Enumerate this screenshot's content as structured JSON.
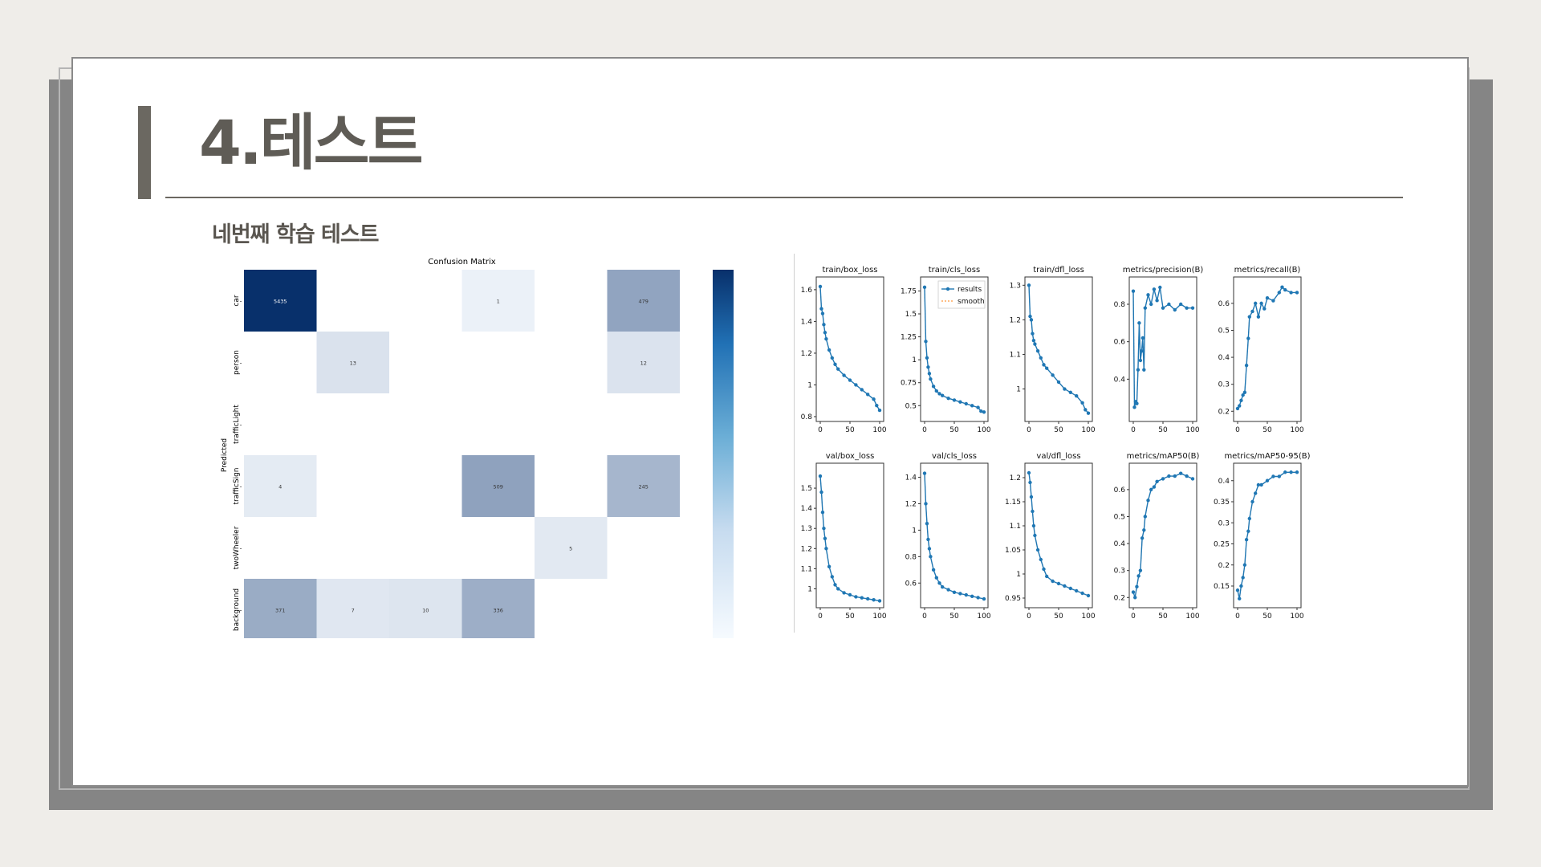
{
  "slide": {
    "title": "4.테스트",
    "subtitle": "네번째 학습 테스트"
  },
  "colors": {
    "accent": "#6b6861",
    "cm_dark": "#08306b",
    "series_blue": "#1f77b4",
    "smooth_orange": "#ff7f0e"
  },
  "chart_data": [
    {
      "type": "heatmap",
      "title": "Confusion Matrix",
      "ylabel": "Predicted",
      "rows": [
        "car",
        "person",
        "trafficLight",
        "trafficSign",
        "twoWheeler",
        "background"
      ],
      "colorbar": true,
      "cells": [
        [
          5435,
          null,
          null,
          1,
          null,
          479
        ],
        [
          null,
          13,
          null,
          null,
          null,
          12
        ],
        [
          null,
          null,
          null,
          null,
          null,
          null
        ],
        [
          4,
          null,
          null,
          509,
          null,
          245
        ],
        [
          null,
          null,
          null,
          null,
          5,
          null
        ],
        [
          371,
          7,
          10,
          336,
          null,
          null
        ]
      ],
      "vmax": 5435
    },
    {
      "type": "line",
      "legend": [
        "results",
        "smooth"
      ],
      "legend_placement": "top-right",
      "xticks": [
        0,
        50,
        100
      ],
      "subplots": [
        {
          "title": "train/box_loss",
          "yticks": [
            0.8,
            1.0,
            1.2,
            1.4,
            1.6
          ],
          "ylim": [
            0.8,
            1.65
          ],
          "x": [
            0,
            2,
            4,
            6,
            8,
            10,
            15,
            20,
            25,
            30,
            40,
            50,
            60,
            70,
            80,
            90,
            95,
            100
          ],
          "y": [
            1.62,
            1.48,
            1.45,
            1.38,
            1.33,
            1.29,
            1.22,
            1.17,
            1.13,
            1.1,
            1.06,
            1.03,
            1.0,
            0.97,
            0.94,
            0.91,
            0.87,
            0.84
          ]
        },
        {
          "title": "train/cls_loss",
          "yticks": [
            0.5,
            0.75,
            1.0,
            1.25,
            1.5,
            1.75
          ],
          "ylim": [
            0.38,
            1.85
          ],
          "x": [
            0,
            2,
            4,
            6,
            8,
            10,
            15,
            20,
            25,
            30,
            40,
            50,
            60,
            70,
            80,
            90,
            95,
            100
          ],
          "y": [
            1.79,
            1.2,
            1.02,
            0.92,
            0.85,
            0.79,
            0.71,
            0.66,
            0.63,
            0.61,
            0.58,
            0.56,
            0.54,
            0.52,
            0.5,
            0.48,
            0.44,
            0.43
          ]
        },
        {
          "title": "train/dfl_loss",
          "yticks": [
            1.0,
            1.1,
            1.2,
            1.3
          ],
          "ylim": [
            0.92,
            1.31
          ],
          "x": [
            0,
            2,
            4,
            6,
            8,
            10,
            15,
            20,
            25,
            30,
            40,
            50,
            60,
            70,
            80,
            90,
            95,
            100
          ],
          "y": [
            1.3,
            1.21,
            1.2,
            1.16,
            1.14,
            1.13,
            1.11,
            1.09,
            1.07,
            1.06,
            1.04,
            1.02,
            1.0,
            0.99,
            0.98,
            0.96,
            0.94,
            0.93
          ]
        },
        {
          "title": "metrics/precision(B)",
          "yticks": [
            0.4,
            0.6,
            0.8
          ],
          "ylim": [
            0.2,
            0.92
          ],
          "x": [
            0,
            2,
            4,
            6,
            8,
            10,
            12,
            14,
            16,
            18,
            20,
            25,
            30,
            35,
            40,
            45,
            50,
            60,
            70,
            80,
            90,
            100
          ],
          "y": [
            0.87,
            0.25,
            0.28,
            0.27,
            0.45,
            0.7,
            0.5,
            0.55,
            0.62,
            0.45,
            0.78,
            0.85,
            0.8,
            0.88,
            0.82,
            0.89,
            0.78,
            0.8,
            0.77,
            0.8,
            0.78,
            0.78
          ]
        },
        {
          "title": "metrics/recall(B)",
          "yticks": [
            0.2,
            0.3,
            0.4,
            0.5,
            0.6
          ],
          "ylim": [
            0.18,
            0.68
          ],
          "x": [
            0,
            3,
            6,
            9,
            12,
            15,
            18,
            20,
            25,
            30,
            35,
            40,
            45,
            50,
            60,
            70,
            75,
            80,
            90,
            100
          ],
          "y": [
            0.21,
            0.22,
            0.24,
            0.26,
            0.27,
            0.37,
            0.47,
            0.55,
            0.57,
            0.6,
            0.55,
            0.6,
            0.58,
            0.62,
            0.61,
            0.64,
            0.66,
            0.65,
            0.64,
            0.64
          ]
        },
        {
          "title": "val/box_loss",
          "yticks": [
            1.0,
            1.1,
            1.2,
            1.3,
            1.4,
            1.5
          ],
          "ylim": [
            0.93,
            1.6
          ],
          "x": [
            0,
            2,
            4,
            6,
            8,
            10,
            15,
            20,
            25,
            30,
            40,
            50,
            60,
            70,
            80,
            90,
            100
          ],
          "y": [
            1.56,
            1.48,
            1.38,
            1.3,
            1.25,
            1.2,
            1.11,
            1.06,
            1.02,
            1.0,
            0.98,
            0.97,
            0.96,
            0.955,
            0.95,
            0.945,
            0.94
          ]
        },
        {
          "title": "val/cls_loss",
          "yticks": [
            0.6,
            0.8,
            1.0,
            1.2,
            1.4
          ],
          "ylim": [
            0.45,
            1.47
          ],
          "x": [
            0,
            2,
            4,
            6,
            8,
            10,
            15,
            20,
            25,
            30,
            40,
            50,
            60,
            70,
            80,
            90,
            100
          ],
          "y": [
            1.43,
            1.2,
            1.05,
            0.93,
            0.86,
            0.8,
            0.7,
            0.64,
            0.6,
            0.57,
            0.55,
            0.53,
            0.52,
            0.51,
            0.5,
            0.49,
            0.48
          ]
        },
        {
          "title": "val/dfl_loss",
          "yticks": [
            0.95,
            1.0,
            1.05,
            1.1,
            1.15,
            1.2
          ],
          "ylim": [
            0.94,
            1.22
          ],
          "x": [
            0,
            2,
            4,
            6,
            8,
            10,
            15,
            20,
            25,
            30,
            40,
            50,
            60,
            70,
            80,
            90,
            100
          ],
          "y": [
            1.21,
            1.19,
            1.16,
            1.13,
            1.1,
            1.08,
            1.05,
            1.03,
            1.01,
            0.995,
            0.985,
            0.98,
            0.975,
            0.97,
            0.965,
            0.96,
            0.955
          ]
        },
        {
          "title": "metrics/mAP50(B)",
          "yticks": [
            0.2,
            0.3,
            0.4,
            0.5,
            0.6
          ],
          "ylim": [
            0.18,
            0.68
          ],
          "x": [
            0,
            3,
            6,
            9,
            12,
            15,
            18,
            20,
            25,
            30,
            35,
            40,
            50,
            60,
            70,
            80,
            90,
            100
          ],
          "y": [
            0.22,
            0.2,
            0.24,
            0.28,
            0.3,
            0.42,
            0.45,
            0.5,
            0.56,
            0.6,
            0.61,
            0.63,
            0.64,
            0.65,
            0.65,
            0.66,
            0.65,
            0.64
          ]
        },
        {
          "title": "metrics/mAP50-95(B)",
          "yticks": [
            0.15,
            0.2,
            0.25,
            0.3,
            0.35,
            0.4
          ],
          "ylim": [
            0.11,
            0.43
          ],
          "x": [
            0,
            3,
            6,
            9,
            12,
            15,
            18,
            20,
            25,
            30,
            35,
            40,
            50,
            60,
            70,
            80,
            90,
            100
          ],
          "y": [
            0.14,
            0.12,
            0.15,
            0.17,
            0.2,
            0.26,
            0.28,
            0.31,
            0.35,
            0.37,
            0.39,
            0.39,
            0.4,
            0.41,
            0.41,
            0.42,
            0.42,
            0.42
          ]
        }
      ]
    }
  ]
}
